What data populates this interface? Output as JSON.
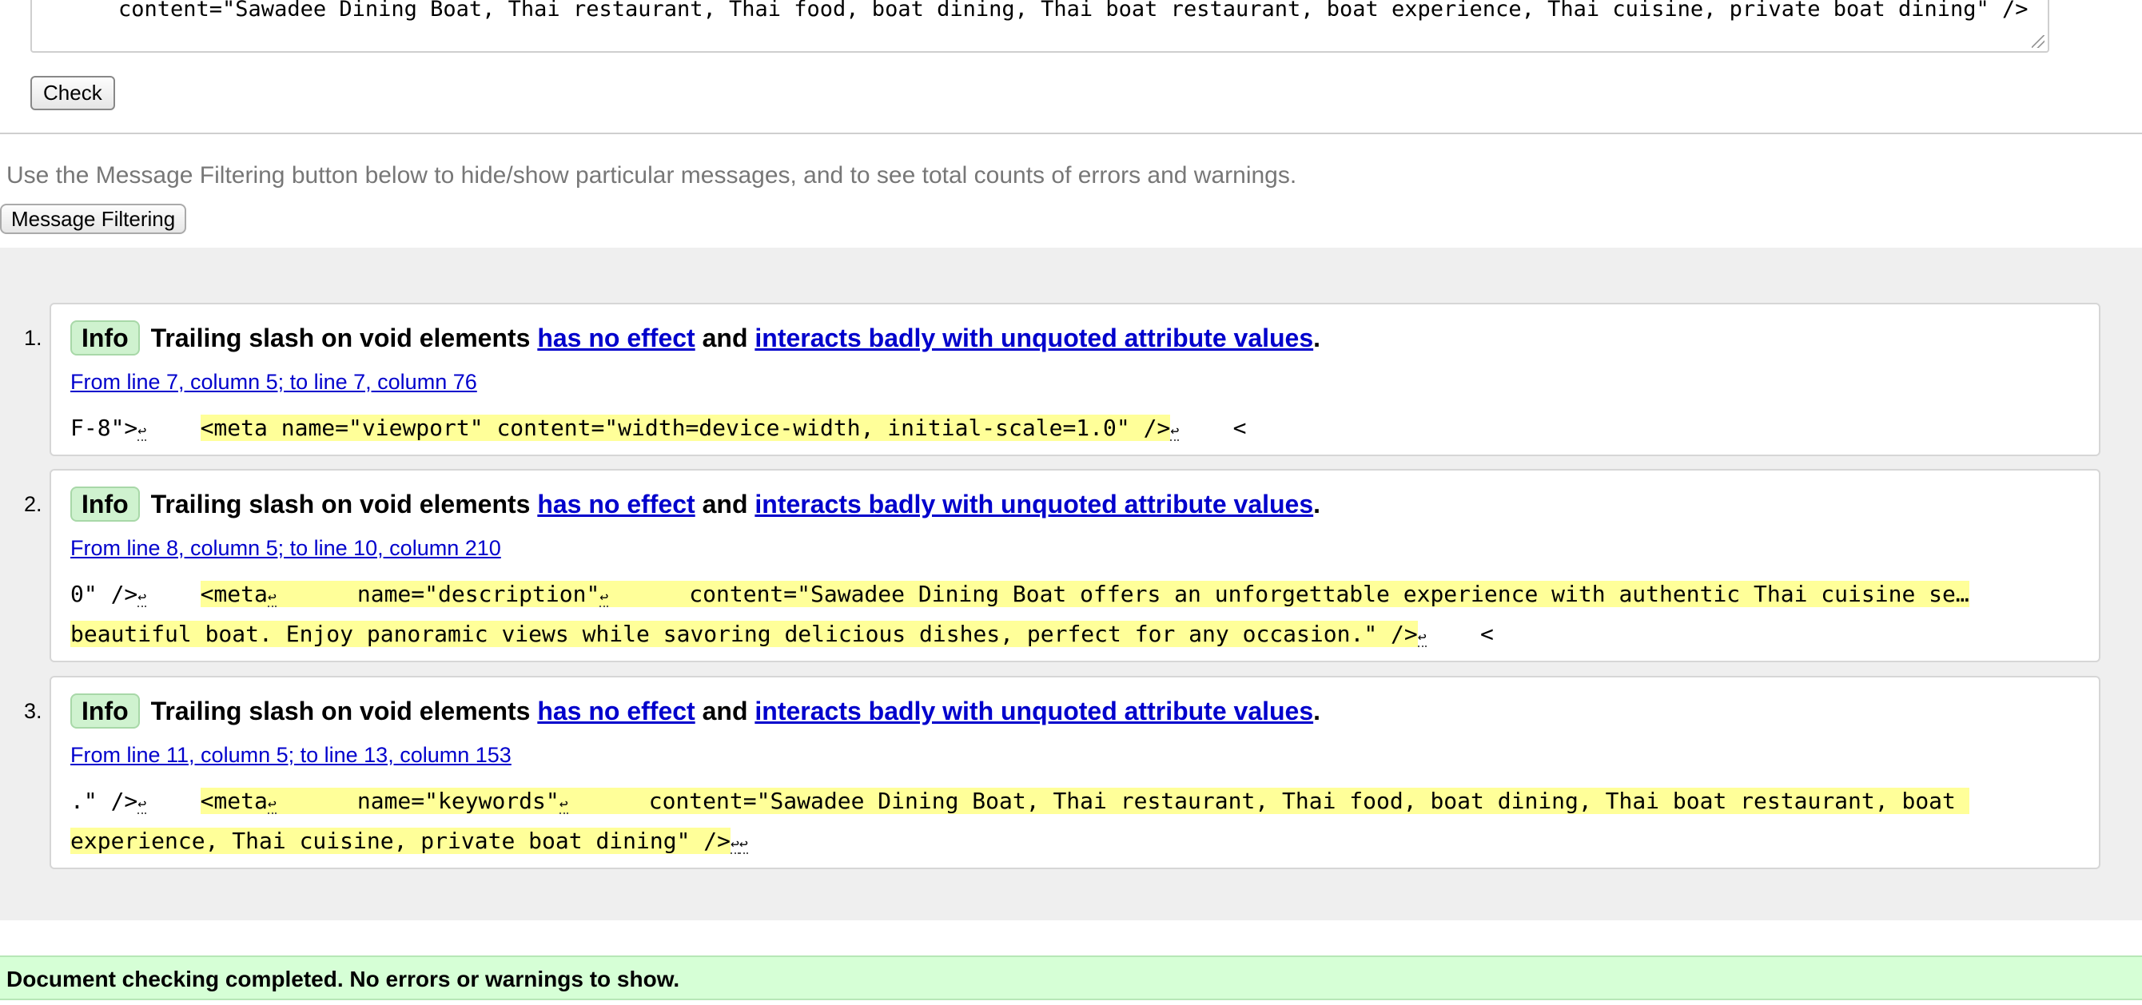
{
  "input": {
    "textarea_last_line": "content=\"Sawadee Dining Boat, Thai restaurant, Thai food, boat dining, Thai boat restaurant, boat experience, Thai cuisine, private boat dining\" />",
    "check_label": "Check"
  },
  "filter": {
    "hint": "Use the Message Filtering button below to hide/show particular messages, and to see total counts of errors and warnings.",
    "button_label": "Message Filtering"
  },
  "messages": [
    {
      "number": "1.",
      "badge": "Info",
      "title_prefix": "Trailing slash on void elements",
      "link1": "has no effect",
      "conj": "and",
      "link2": "interacts badly with unquoted attribute values",
      "period": ".",
      "location": "From line 7, column 5; to line 7, column 76",
      "pre": "F-8\">",
      "highlight": "<meta name=\"viewport\" content=\"width=device-width, initial-scale=1.0\" />",
      "post": "    <"
    },
    {
      "number": "2.",
      "badge": "Info",
      "title_prefix": "Trailing slash on void elements",
      "link1": "has no effect",
      "conj": "and",
      "link2": "interacts badly with unquoted attribute values",
      "period": ".",
      "location": "From line 8, column 5; to line 10, column 210",
      "pre": "0\" />",
      "hl_a": "<meta",
      "hl_b": "      name=\"description\"",
      "hl_c": "      content=\"Sawadee Dining Boat offers an unforgettable experience with authentic Thai cuisine se…",
      "hl_d": "beautiful boat. Enjoy panoramic views while savoring delicious dishes, perfect for any occasion.\" />",
      "post": "    <"
    },
    {
      "number": "3.",
      "badge": "Info",
      "title_prefix": "Trailing slash on void elements",
      "link1": "has no effect",
      "conj": "and",
      "link2": "interacts badly with unquoted attribute values",
      "period": ".",
      "location": "From line 11, column 5; to line 13, column 153",
      "pre": ".\" />",
      "hl_a": "<meta",
      "hl_b": "      name=\"keywords\"",
      "hl_c": "      content=\"Sawadee Dining Boat, Thai restaurant, Thai food, boat dining, Thai boat restaurant, boat ",
      "hl_d": "experience, Thai cuisine, private boat dining\" />"
    }
  ],
  "newline_glyph": "↩",
  "status": {
    "text": "Document checking completed. No errors or warnings to show."
  }
}
